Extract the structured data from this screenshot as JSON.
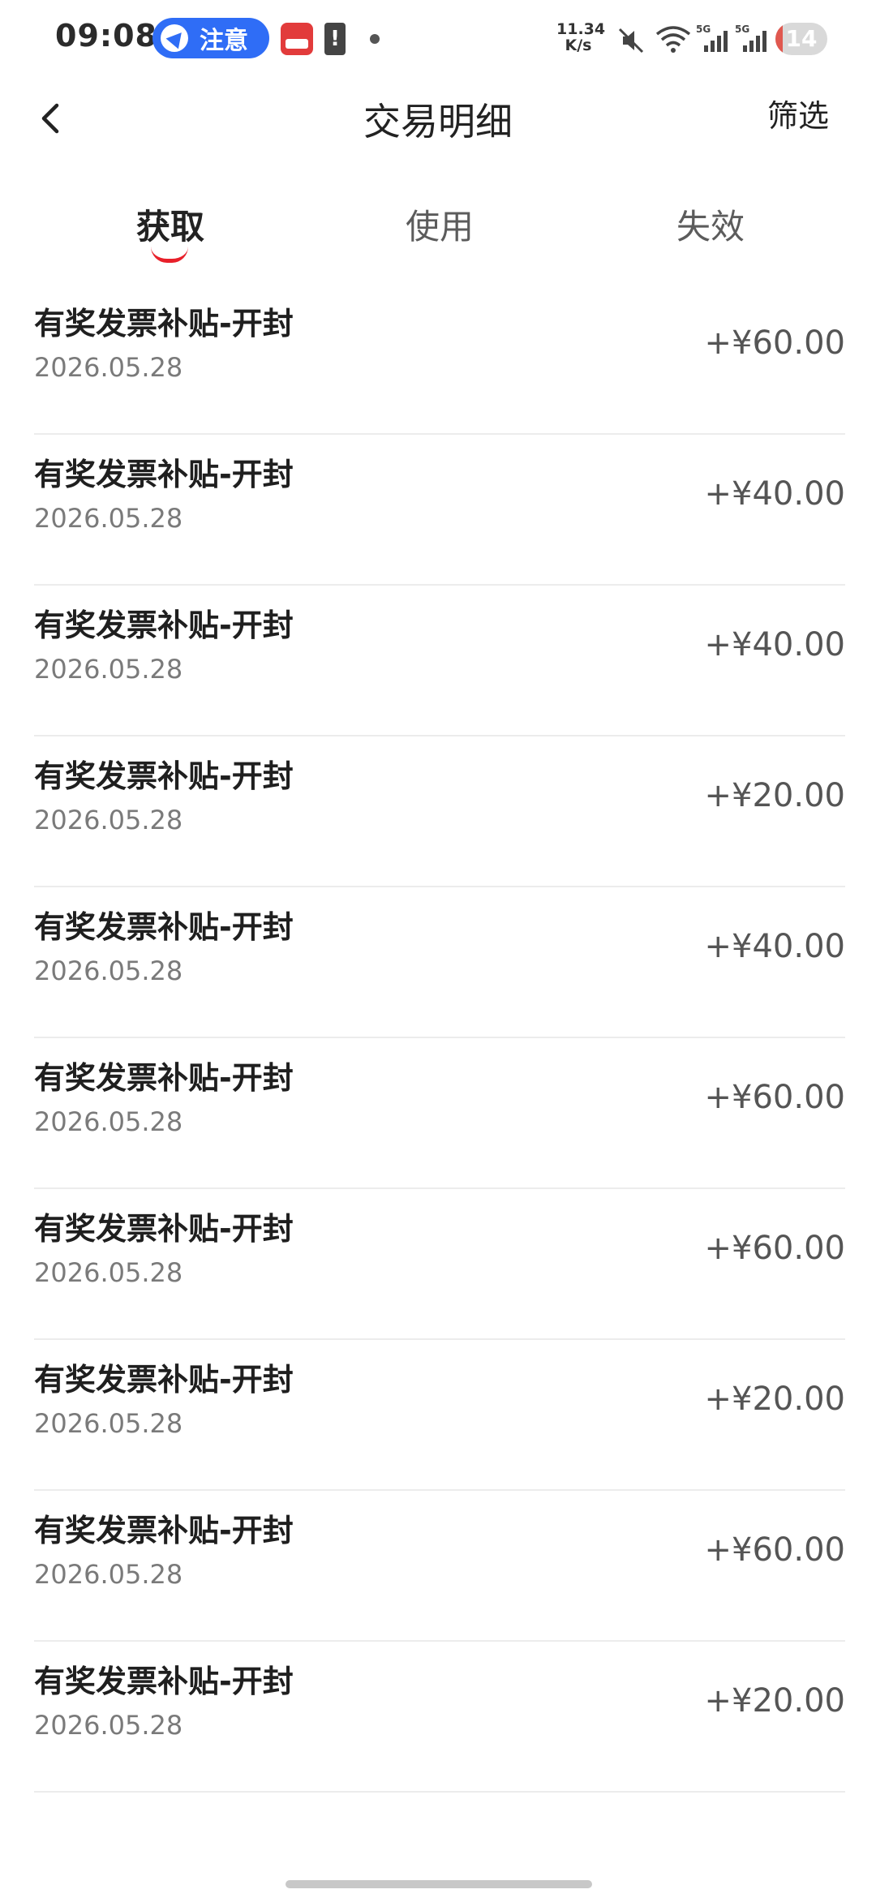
{
  "status_bar": {
    "time": "09:08",
    "notice_pill": "注意",
    "net_speed_value": "11.34",
    "net_speed_unit": "K/s",
    "battery": "14",
    "battery_level_percent": 14,
    "battery_color": "#e0584f",
    "icons": [
      "app-notification-icon",
      "alert-icon",
      "dot-icon",
      "mute-icon",
      "wifi-icon",
      "5g-signal-icon",
      "5g-signal-icon"
    ]
  },
  "header": {
    "title": "交易明细",
    "filter_label": "筛选",
    "back_icon": "chevron-left-icon"
  },
  "tabs": [
    {
      "label": "获取",
      "active": true
    },
    {
      "label": "使用",
      "active": false
    },
    {
      "label": "失效",
      "active": false
    }
  ],
  "accent_color": "#e8202a",
  "transactions": [
    {
      "title": "有奖发票补贴-开封",
      "date": "2026.05.28",
      "amount": "+¥60.00"
    },
    {
      "title": "有奖发票补贴-开封",
      "date": "2026.05.28",
      "amount": "+¥40.00"
    },
    {
      "title": "有奖发票补贴-开封",
      "date": "2026.05.28",
      "amount": "+¥40.00"
    },
    {
      "title": "有奖发票补贴-开封",
      "date": "2026.05.28",
      "amount": "+¥20.00"
    },
    {
      "title": "有奖发票补贴-开封",
      "date": "2026.05.28",
      "amount": "+¥40.00"
    },
    {
      "title": "有奖发票补贴-开封",
      "date": "2026.05.28",
      "amount": "+¥60.00"
    },
    {
      "title": "有奖发票补贴-开封",
      "date": "2026.05.28",
      "amount": "+¥60.00"
    },
    {
      "title": "有奖发票补贴-开封",
      "date": "2026.05.28",
      "amount": "+¥20.00"
    },
    {
      "title": "有奖发票补贴-开封",
      "date": "2026.05.28",
      "amount": "+¥60.00"
    },
    {
      "title": "有奖发票补贴-开封",
      "date": "2026.05.28",
      "amount": "+¥20.00"
    }
  ]
}
